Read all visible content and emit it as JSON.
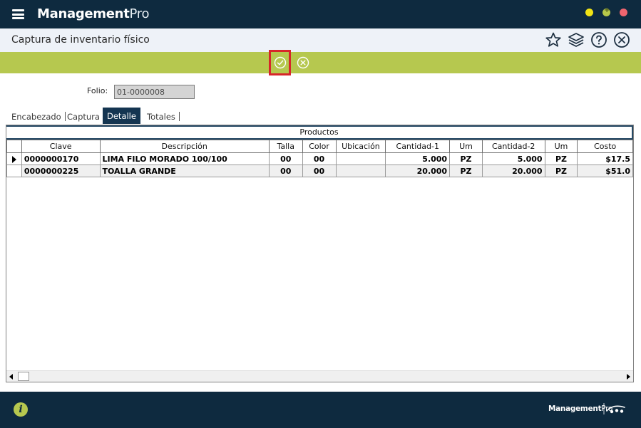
{
  "app": {
    "brand_bold": "Management",
    "brand_light": "Pro"
  },
  "header": {
    "title": "Captura de inventario físico"
  },
  "folio": {
    "label": "Folio:",
    "value": "01-0000008"
  },
  "tabs": [
    {
      "label": "Encabezado"
    },
    {
      "label": "Captura"
    },
    {
      "label": "Detalle"
    },
    {
      "label": "Totales"
    }
  ],
  "grid": {
    "group_title": "Productos",
    "columns": [
      "Clave",
      "Descripción",
      "Talla",
      "Color",
      "Ubicación",
      "Cantidad-1",
      "Um",
      "Cantidad-2",
      "Um",
      "Costo"
    ],
    "rows": [
      {
        "clave": "0000000170",
        "descripcion": "LIMA FILO MORADO 100/100",
        "talla": "00",
        "color": "00",
        "ubicacion": "",
        "cantidad1": "5.000",
        "um1": "PZ",
        "cantidad2": "5.000",
        "um2": "PZ",
        "costo": "$17.5"
      },
      {
        "clave": "0000000225",
        "descripcion": "TOALLA GRANDE",
        "talla": "00",
        "color": "00",
        "ubicacion": "",
        "cantidad1": "20.000",
        "um1": "PZ",
        "cantidad2": "20.000",
        "um2": "PZ",
        "costo": "$51.0"
      }
    ]
  },
  "footer": {
    "brand_bold": "Management",
    "brand_light": "Pro",
    "info_icon": "i"
  },
  "colors": {
    "titlebar": "#0e2a3f",
    "accent_green": "#b6c84f",
    "active_tab": "#143551",
    "highlight_red": "#d7262a"
  },
  "icons": [
    "hamburger-icon",
    "star-icon",
    "layers-icon",
    "help-icon",
    "close-circle-icon",
    "check-circle-icon",
    "cancel-circle-icon",
    "info-icon"
  ]
}
